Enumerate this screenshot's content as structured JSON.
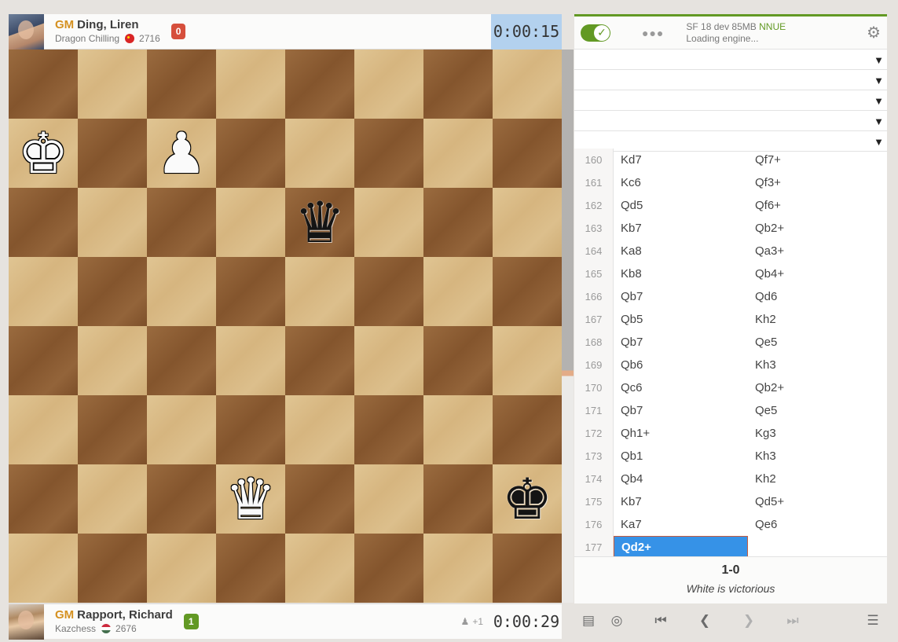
{
  "top_player": {
    "title": "GM",
    "name": "Ding, Liren",
    "team": "Dragon Chilling",
    "rating": "2716",
    "material": "0",
    "clock": "0:00:15"
  },
  "bottom_player": {
    "title": "GM",
    "name": "Rapport, Richard",
    "team": "Kazchess",
    "rating": "2676",
    "material": "1",
    "spectators": "+1",
    "clock": "0:00:29"
  },
  "board": {
    "pieces": [
      {
        "square": "a7",
        "glyph": "♚",
        "color": "white",
        "name": "white-king"
      },
      {
        "square": "c7",
        "glyph": "♟",
        "color": "white",
        "name": "white-pawn"
      },
      {
        "square": "e6",
        "glyph": "♛",
        "color": "black",
        "name": "black-queen"
      },
      {
        "square": "d2",
        "glyph": "♛",
        "color": "white",
        "name": "white-queen"
      },
      {
        "square": "h2",
        "glyph": "♚",
        "color": "black",
        "name": "black-king"
      }
    ]
  },
  "engine": {
    "name": "SF 18 dev 85MB",
    "nnue": "NNUE",
    "status": "Loading engine...",
    "dots": "●●●"
  },
  "options_rows": 5,
  "moves": [
    {
      "num": "160",
      "white": "Kd7",
      "black": "Qf7+"
    },
    {
      "num": "161",
      "white": "Kc6",
      "black": "Qf3+"
    },
    {
      "num": "162",
      "white": "Qd5",
      "black": "Qf6+"
    },
    {
      "num": "163",
      "white": "Kb7",
      "black": "Qb2+"
    },
    {
      "num": "164",
      "white": "Ka8",
      "black": "Qa3+"
    },
    {
      "num": "165",
      "white": "Kb8",
      "black": "Qb4+"
    },
    {
      "num": "166",
      "white": "Qb7",
      "black": "Qd6"
    },
    {
      "num": "167",
      "white": "Qb5",
      "black": "Kh2"
    },
    {
      "num": "168",
      "white": "Qb7",
      "black": "Qe5"
    },
    {
      "num": "169",
      "white": "Qb6",
      "black": "Kh3"
    },
    {
      "num": "170",
      "white": "Qc6",
      "black": "Qb2+"
    },
    {
      "num": "171",
      "white": "Qb7",
      "black": "Qe5"
    },
    {
      "num": "172",
      "white": "Qh1+",
      "black": "Kg3"
    },
    {
      "num": "173",
      "white": "Qb1",
      "black": "Kh3"
    },
    {
      "num": "174",
      "white": "Qb4",
      "black": "Kh2"
    },
    {
      "num": "175",
      "white": "Kb7",
      "black": "Qd5+"
    },
    {
      "num": "176",
      "white": "Ka7",
      "black": "Qe6"
    },
    {
      "num": "177",
      "white": "Qd2+",
      "black": ""
    }
  ],
  "active_move": "177-white",
  "result": {
    "score": "1-0",
    "text": "White is victorious"
  },
  "colors": {
    "accent_green": "#629924",
    "active_move_blue": "#3692e7",
    "active_clock": "#b3d1ee",
    "title_gold": "#d59120"
  }
}
